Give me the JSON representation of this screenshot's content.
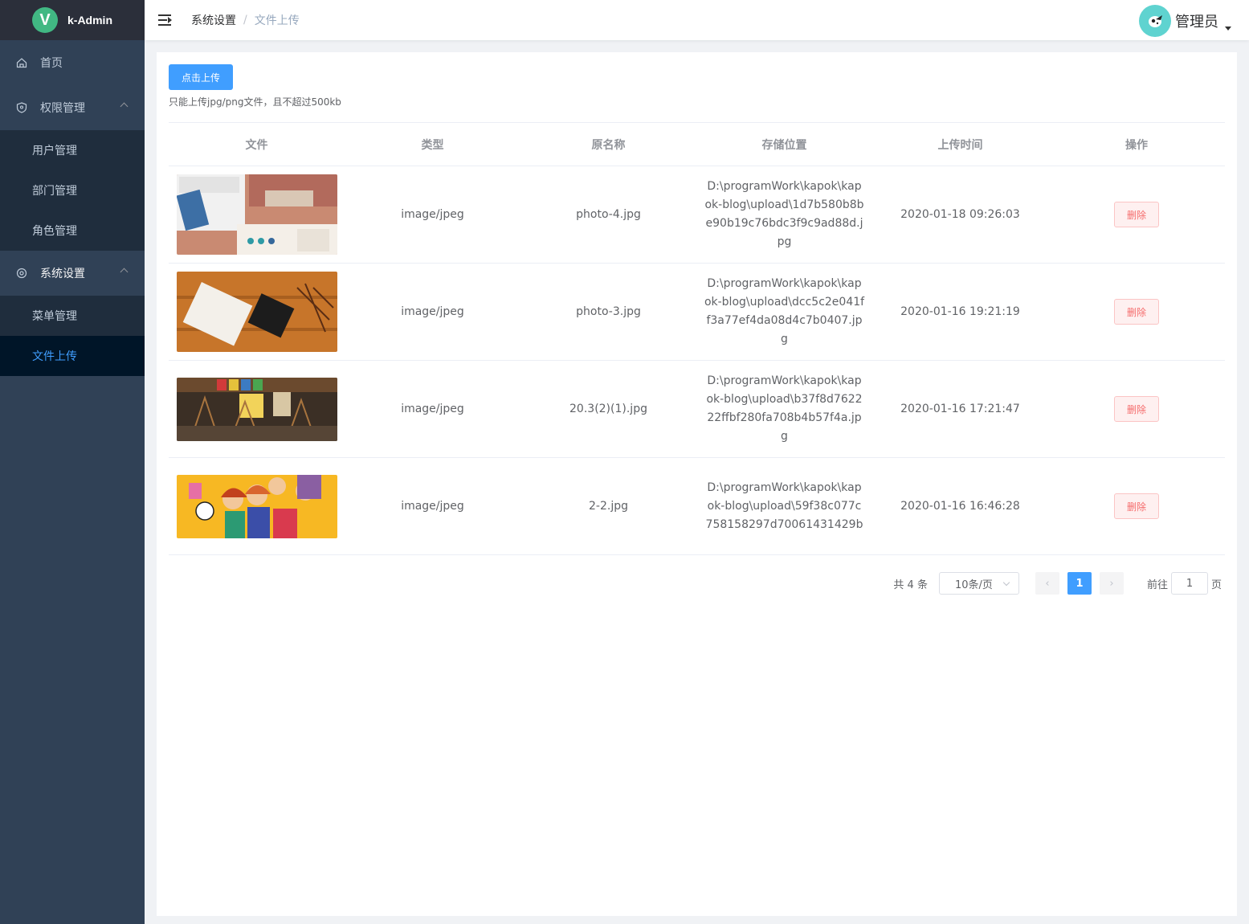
{
  "app": {
    "logo_letter": "V",
    "title": "k-Admin"
  },
  "sidebar": {
    "items": [
      {
        "label": "首页",
        "icon": "home-icon"
      },
      {
        "label": "权限管理",
        "icon": "shield-icon",
        "children": [
          "用户管理",
          "部门管理",
          "角色管理"
        ]
      },
      {
        "label": "系统设置",
        "icon": "settings-icon",
        "children": [
          "菜单管理",
          "文件上传"
        ]
      }
    ],
    "active": "文件上传"
  },
  "header": {
    "breadcrumb": [
      "系统设置",
      "文件上传"
    ],
    "separator": "/",
    "user_name": "管理员"
  },
  "upload": {
    "button_label": "点击上传",
    "tip": "只能上传jpg/png文件，且不超过500kb"
  },
  "table": {
    "columns": [
      "文件",
      "类型",
      "原名称",
      "存储位置",
      "上传时间",
      "操作"
    ],
    "rows": [
      {
        "type": "image/jpeg",
        "name": "photo-4.jpg",
        "path": "D:\\programWork\\kapok\\kapok-blog\\upload\\1d7b580b8be90b19c76bdc3f9c9ad88d.jpg",
        "time": "2020-01-18 09:26:03",
        "action": "删除"
      },
      {
        "type": "image/jpeg",
        "name": "photo-3.jpg",
        "path": "D:\\programWork\\kapok\\kapok-blog\\upload\\dcc5c2e041ff3a77ef4da08d4c7b0407.jpg",
        "time": "2020-01-16 19:21:19",
        "action": "删除"
      },
      {
        "type": "image/jpeg",
        "name": "20.3(2)(1).jpg",
        "path": "D:\\programWork\\kapok\\kapok-blog\\upload\\b37f8d762222ffbf280fa708b4b57f4a.jpg",
        "time": "2020-01-16 17:21:47",
        "action": "删除"
      },
      {
        "type": "image/jpeg",
        "name": "2-2.jpg",
        "path": "D:\\programWork\\kapok\\kapok-blog\\upload\\59f38c077c758158297d70061431429b",
        "time": "2020-01-16 16:46:28",
        "action": "删除"
      }
    ]
  },
  "pagination": {
    "total": "共 4 条",
    "page_size": "10条/页",
    "prev": "‹",
    "current": "1",
    "next": "›",
    "goto_label": "前往",
    "goto_value": "1",
    "page_suffix": "页"
  }
}
